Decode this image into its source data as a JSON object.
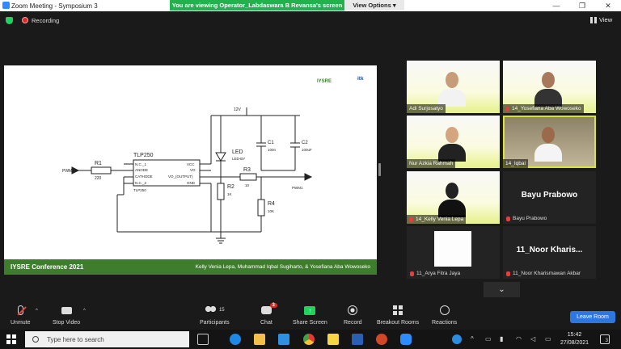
{
  "window": {
    "title": "Zoom Meeting - Symposium 3",
    "minimize": "—",
    "maximize": "❐",
    "close": "✕"
  },
  "banner": {
    "text": "You are viewing Operator_Labdaswara B Revansa's screen",
    "view_options": "View Options ▾"
  },
  "topbar": {
    "recording": "Recording",
    "view": "View"
  },
  "slide": {
    "footer_left": "IYSRE Conference 2021",
    "footer_right": "Kelly Venia Lepa, Muhammad Iqbal Sugiharto, & Yosefiana Aba Wowoseko",
    "logo": "IYSRE",
    "logo2": "itk",
    "circuit": {
      "ic_name": "TLP250",
      "ic_sub": "TLP250",
      "pins_left": [
        "N.C._1",
        "ANODE",
        "CATHODE",
        "N.C._2"
      ],
      "pins_right": [
        "VCC",
        "VO",
        "VO_(OUTPUT)",
        "GND"
      ],
      "pwm_in": "PWM",
      "r1": "R1",
      "r1_val": "220",
      "v12": "12V",
      "led": "LED",
      "led_sub": "LED-BY",
      "c1": "C1",
      "c1_val": "100n",
      "c2": "C2",
      "c2_val": "100uF",
      "r2": "R2",
      "r2_val": "1K",
      "r3": "R3",
      "r3_val": "10",
      "r4": "R4",
      "r4_val": "10K",
      "pwm_out": "PWM1"
    }
  },
  "participants": [
    {
      "name": "Adi Surjosatyo",
      "type": "video"
    },
    {
      "name": "14_Yosefiana Aba Wowoseko",
      "type": "video"
    },
    {
      "name": "Nur Azkia Rahmah",
      "type": "video"
    },
    {
      "name": "14_Iqbal",
      "type": "video"
    },
    {
      "name": "14_Kelly Venia Lepa",
      "type": "video"
    },
    {
      "name": "Bayu Prabowo",
      "type": "name",
      "big": "Bayu Prabowo"
    },
    {
      "name": "11_Arya Fitra Jaya",
      "type": "white"
    },
    {
      "name": "11_Noor Kharismawan Akbar",
      "type": "name",
      "big": "11_Noor  Kharis..."
    }
  ],
  "toolbar": {
    "unmute": "Unmute",
    "stop_video": "Stop Video",
    "participants": "Participants",
    "participants_count": "15",
    "chat": "Chat",
    "chat_badge": "3",
    "share_screen": "Share Screen",
    "record": "Record",
    "breakout_rooms": "Breakout Rooms",
    "reactions": "Reactions",
    "leave": "Leave Room",
    "more_chevron": "⌄"
  },
  "taskbar": {
    "search_placeholder": "Type here to search",
    "time": "15:42",
    "date": "27/08/2021",
    "notifications": "3"
  }
}
